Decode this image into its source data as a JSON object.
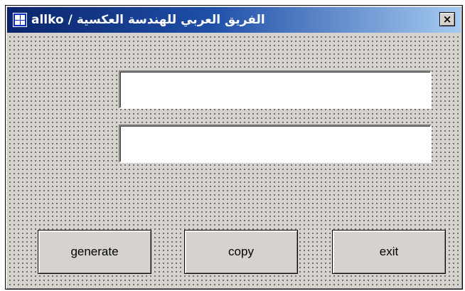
{
  "window": {
    "title": "الفريق العربي للهندسة العكسية / allko",
    "close_glyph": "×",
    "icon": "app-grid-icon"
  },
  "fields": [
    {
      "value": ""
    },
    {
      "value": ""
    }
  ],
  "buttons": {
    "generate": "generate",
    "copy": "copy",
    "exit": "exit"
  },
  "colors": {
    "face": "#d6d3ce",
    "title_start": "#0a246a",
    "title_end": "#a6caf0"
  }
}
